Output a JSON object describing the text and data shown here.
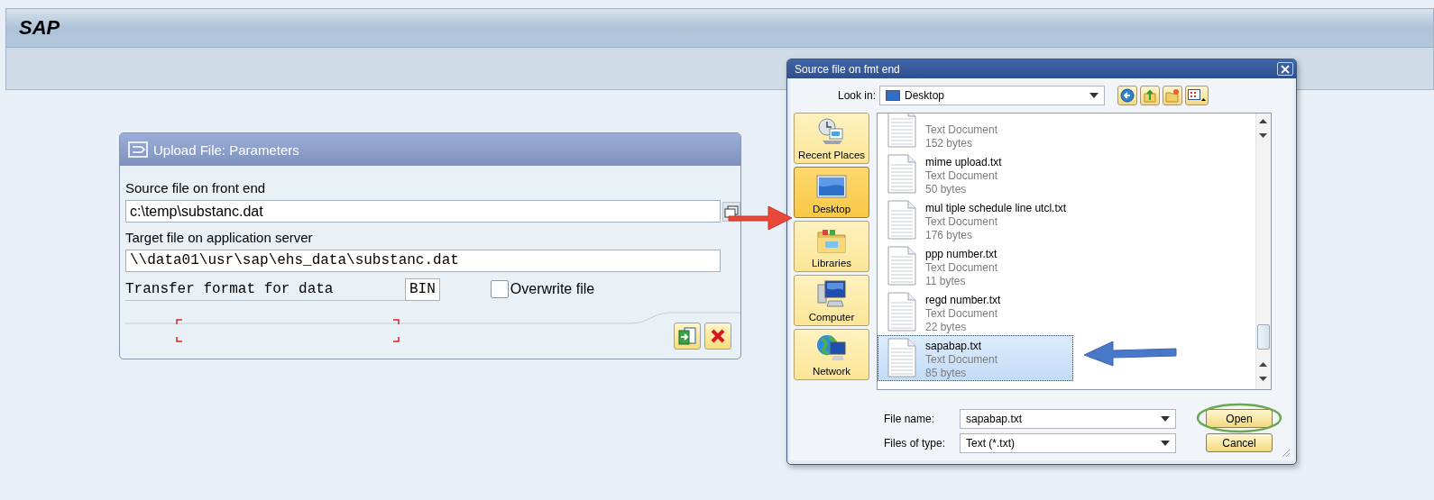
{
  "sap": {
    "title": "SAP"
  },
  "upload_dialog": {
    "title": "Upload File: Parameters",
    "source_label": "Source file on front end",
    "source_value": "c:\\temp\\substanc.dat",
    "target_label": "Target file on application server",
    "target_value": "\\\\data01\\usr\\sap\\ehs_data\\substanc.dat",
    "format_label": "Transfer format for data",
    "format_value": "BIN",
    "overwrite": {
      "label": "Overwrite file",
      "checked": false
    }
  },
  "file_dialog": {
    "title": "Source file on fmt end",
    "look_in_label": "Look in:",
    "look_in_value": "Desktop",
    "places": [
      {
        "kind": "recent",
        "label": "Recent Places",
        "selected": false
      },
      {
        "kind": "desktop",
        "label": "Desktop",
        "selected": true
      },
      {
        "kind": "libraries",
        "label": "Libraries",
        "selected": false
      },
      {
        "kind": "computer",
        "label": "Computer",
        "selected": false
      },
      {
        "kind": "network",
        "label": "Network",
        "selected": false
      }
    ],
    "files": [
      {
        "type": "Text Document",
        "size": "152 bytes",
        "selected": false
      },
      {
        "name": "mime upload.txt",
        "type": "Text Document",
        "size": "50 bytes",
        "selected": false
      },
      {
        "name": "mul tiple schedule line utcl.txt",
        "type": "Text Document",
        "size": "176 bytes",
        "selected": false
      },
      {
        "name": "ppp number.txt",
        "type": "Text Document",
        "size": "11 bytes",
        "selected": false
      },
      {
        "name": "regd number.txt",
        "type": "Text Document",
        "size": "22 bytes",
        "selected": false
      },
      {
        "name": "sapabap.txt",
        "type": "Text Document",
        "size": "85 bytes",
        "selected": true
      }
    ],
    "file_name_label": "File name:",
    "file_name_value": "sapabap.txt",
    "file_type_label": "Files of type:",
    "file_type_value": "Text (*.txt)",
    "buttons": [
      "Open",
      "Cancel"
    ]
  }
}
